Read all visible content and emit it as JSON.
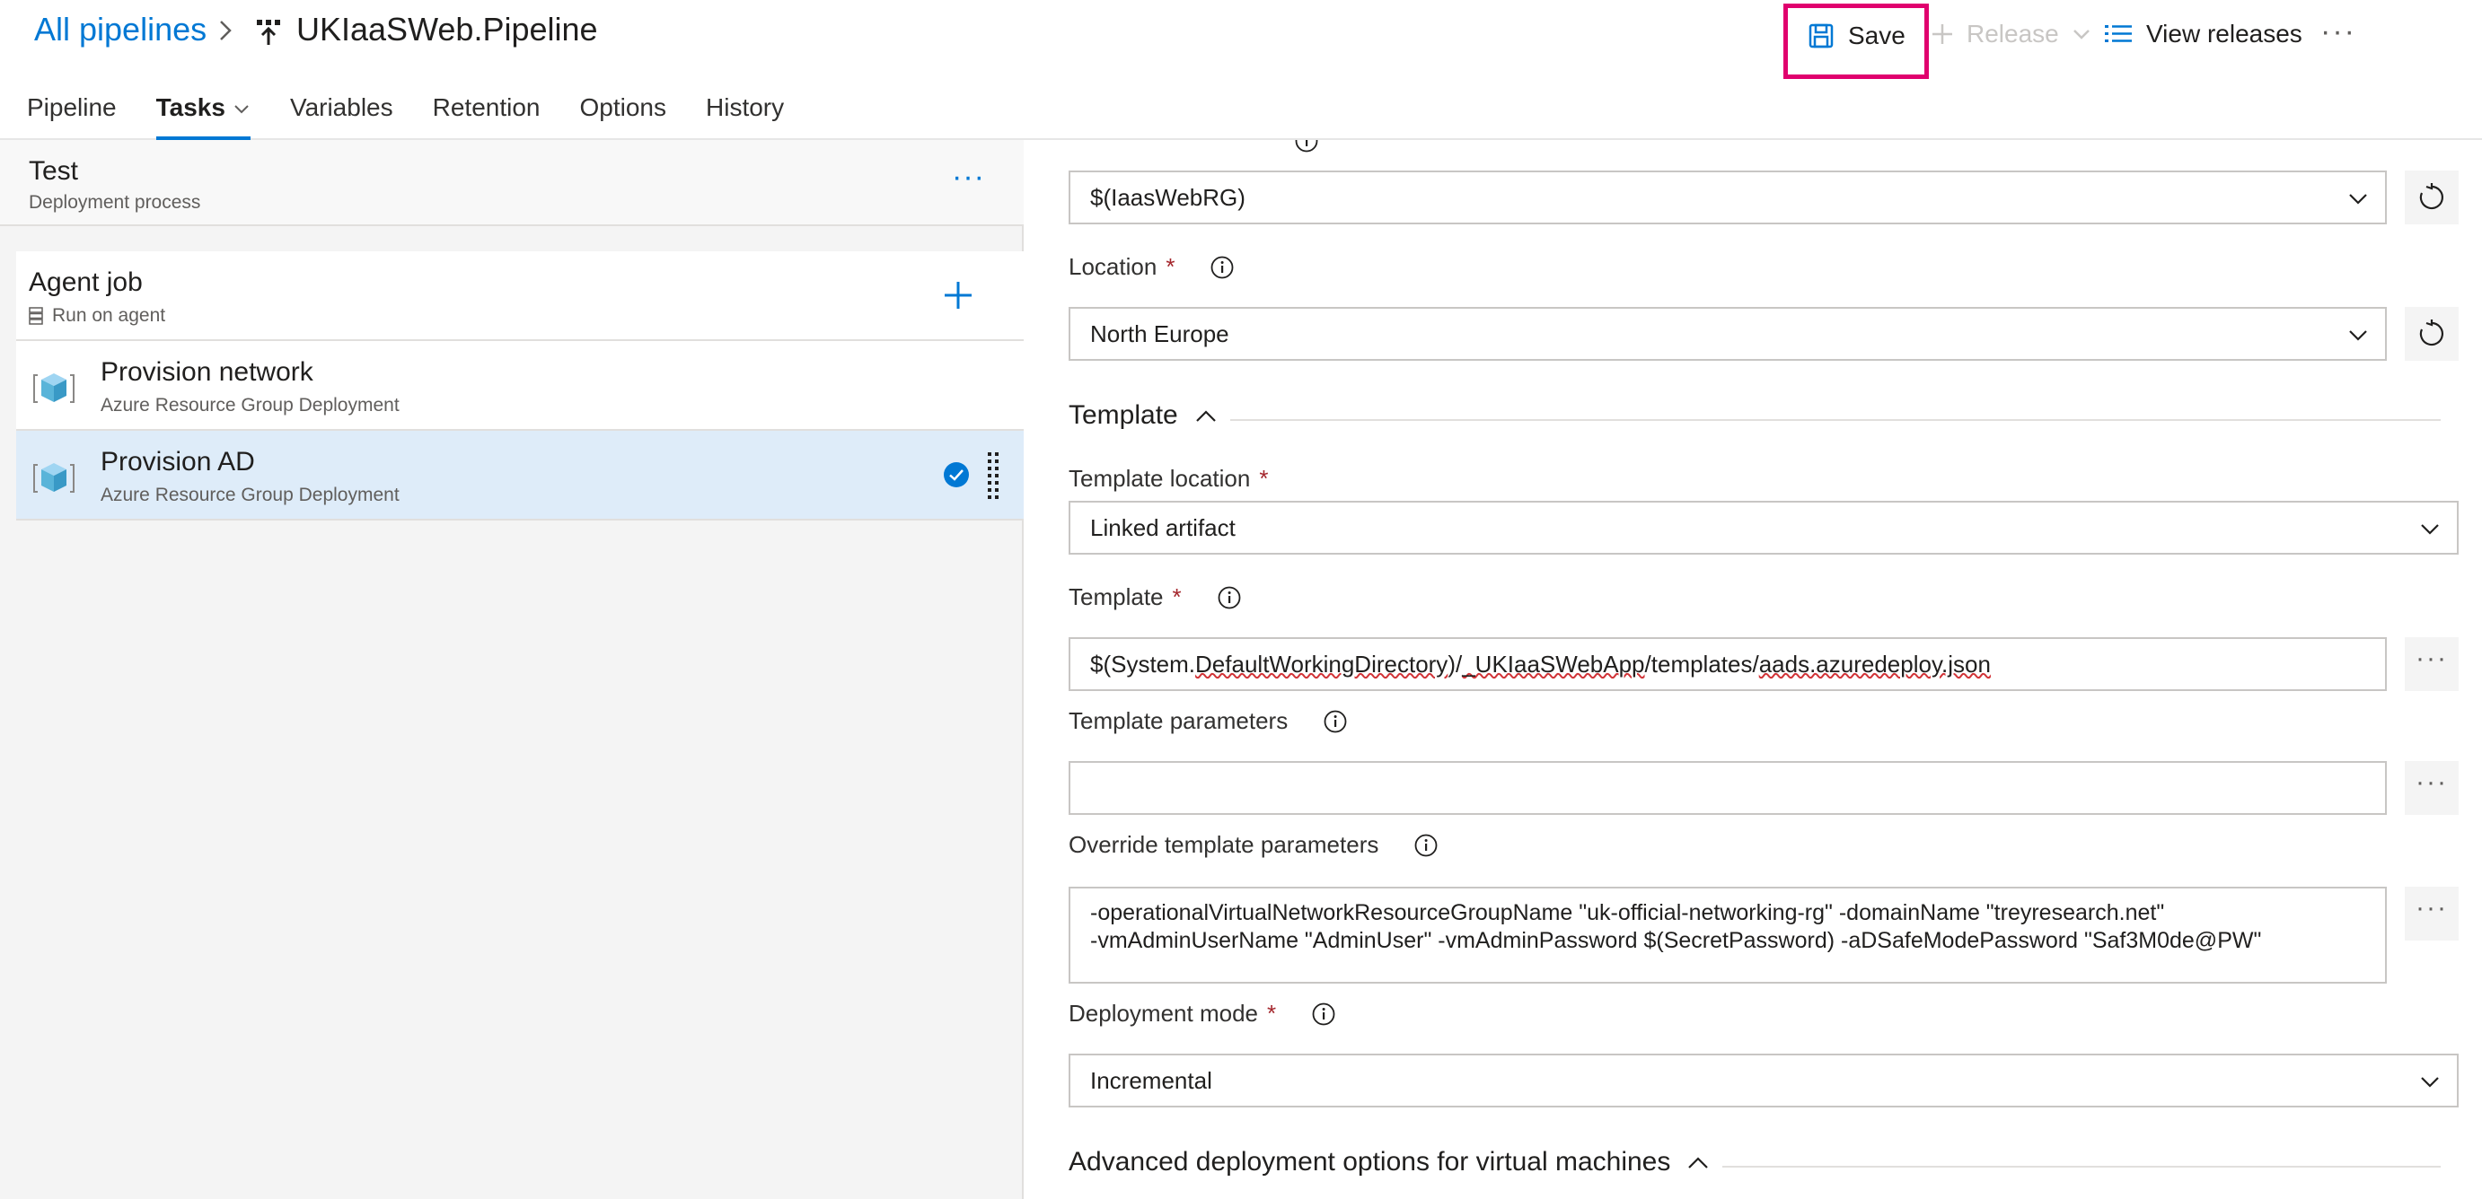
{
  "breadcrumb": {
    "all_pipelines": "All pipelines",
    "pipeline_name": "UKIaaSWeb.Pipeline"
  },
  "toolbar": {
    "save_label": "Save",
    "release_label": "Release",
    "view_releases_label": "View releases",
    "more_label": "···"
  },
  "tabs": [
    {
      "label": "Pipeline",
      "active": false
    },
    {
      "label": "Tasks",
      "active": true
    },
    {
      "label": "Variables",
      "active": false
    },
    {
      "label": "Retention",
      "active": false
    },
    {
      "label": "Options",
      "active": false
    },
    {
      "label": "History",
      "active": false
    }
  ],
  "stage": {
    "title": "Test",
    "subtitle": "Deployment process",
    "more_label": "···"
  },
  "agent_job": {
    "title": "Agent job",
    "subtitle": "Run on agent"
  },
  "tasks": [
    {
      "title": "Provision network",
      "subtitle": "Azure Resource Group Deployment",
      "selected": false
    },
    {
      "title": "Provision AD",
      "subtitle": "Azure Resource Group Deployment",
      "selected": true
    }
  ],
  "form": {
    "resource_group_value": "$(IaasWebRG)",
    "location": {
      "label": "Location",
      "required_mark": "*",
      "value": "North Europe"
    },
    "template_section": {
      "label": "Template"
    },
    "template_location": {
      "label": "Template location",
      "required_mark": "*",
      "value": "Linked artifact"
    },
    "template": {
      "label": "Template",
      "required_mark": "*",
      "value_parts": [
        "$(System.",
        "DefaultWorkingDirectory",
        ")/",
        "_UKIaaSWebApp",
        "/templates/",
        "aads.azuredeploy.json"
      ]
    },
    "template_parameters": {
      "label": "Template parameters",
      "value": ""
    },
    "override_parameters": {
      "label": "Override template parameters",
      "line1": "-operationalVirtualNetworkResourceGroupName \"uk-official-networking-rg\" -domainName \"treyresearch.net\"",
      "line2": "-vmAdminUserName \"AdminUser\" -vmAdminPassword $(SecretPassword) -aDSafeModePassword \"Saf3M0de@PW\""
    },
    "deployment_mode": {
      "label": "Deployment mode",
      "required_mark": "*",
      "value": "Incremental"
    },
    "advanced_section": {
      "label": "Advanced deployment options for virtual machines"
    }
  },
  "colors": {
    "accent": "#0078d4",
    "highlight_box": "#e0006e",
    "required": "#a4262c",
    "selected_row": "#deecf9"
  }
}
